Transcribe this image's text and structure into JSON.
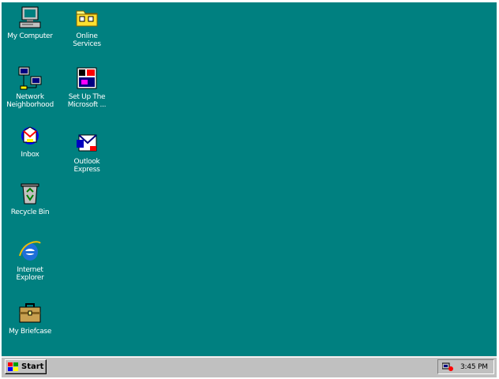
{
  "desktop": {
    "background_color": "#008080",
    "icons": [
      {
        "id": "my-computer",
        "label": "My Computer",
        "icon": "computer-icon"
      },
      {
        "id": "online-services",
        "label": "Online\nServices",
        "icon": "folder-icon"
      },
      {
        "id": "network-neighborhood",
        "label": "Network\nNeighborhood",
        "icon": "network-icon"
      },
      {
        "id": "set-up-msn",
        "label": "Set Up The\nMicrosoft ...",
        "icon": "msn-setup-icon"
      },
      {
        "id": "inbox",
        "label": "Inbox",
        "icon": "inbox-icon"
      },
      {
        "id": "outlook-express",
        "label": "Outlook\nExpress",
        "icon": "outlook-express-icon"
      },
      {
        "id": "recycle-bin",
        "label": "Recycle Bin",
        "icon": "recycle-bin-icon"
      },
      {
        "id": "internet-explorer",
        "label": "Internet\nExplorer",
        "icon": "internet-explorer-icon"
      },
      {
        "id": "my-briefcase",
        "label": "My Briefcase",
        "icon": "briefcase-icon"
      }
    ]
  },
  "taskbar": {
    "start_label": "Start",
    "start_icon": "windows-flag-icon",
    "tray_icon": "network-status-icon",
    "clock": "3:45 PM"
  }
}
